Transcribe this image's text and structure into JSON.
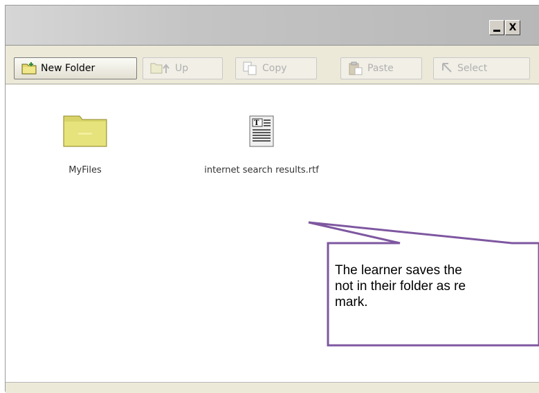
{
  "window": {
    "title": "",
    "controls": {
      "minimize_icon": "minimize-icon",
      "close_label": "X"
    }
  },
  "toolbar": {
    "new_folder": {
      "label": "New Folder",
      "icon": "new-folder-icon",
      "enabled": true
    },
    "up": {
      "label": "Up",
      "icon": "folder-up-icon",
      "enabled": false
    },
    "copy": {
      "label": "Copy",
      "icon": "copy-icon",
      "enabled": false
    },
    "paste": {
      "label": "Paste",
      "icon": "paste-icon",
      "enabled": false
    },
    "select": {
      "label": "Select",
      "icon": "arrow-cursor-icon",
      "enabled": false
    }
  },
  "files": [
    {
      "name": "MyFiles",
      "type": "folder",
      "icon": "folder-icon"
    },
    {
      "name": "internet search results.rtf",
      "type": "document",
      "icon": "rtf-document-icon"
    }
  ],
  "annotation": {
    "lines": [
      "The learner saves the",
      "not in their folder as re",
      "mark."
    ],
    "color": "#7e57a0"
  }
}
